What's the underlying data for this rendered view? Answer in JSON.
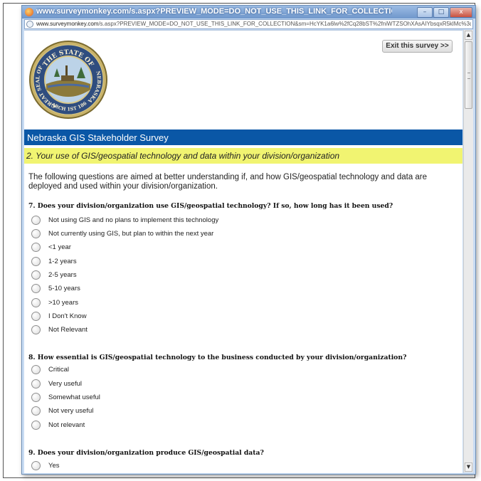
{
  "window": {
    "title": "www.surveymonkey.com/s.aspx?PREVIEW_MODE=DO_NOT_USE_THIS_LINK_FOR_COLLECTION&sm=HcYK1a6lw%2f...",
    "address_domain": "www.surveymonkey.com",
    "address_path": "/s.aspx?PREVIEW_MODE=DO_NOT_USE_THIS_LINK_FOR_COLLECTION&sm=HcYK1a6lw%2fCq28bST%2fniWTZSOhXAsAIYbsqxR5klMc%3d",
    "btn_min": "–",
    "btn_max": "□",
    "btn_close": "x"
  },
  "seal": {
    "top_text": "THE STATE OF",
    "left_text": "GREAT SEAL OF",
    "right_text": "NEBRASKA",
    "bottom_text": "MARCH 1ST 1867"
  },
  "exit_button": "Exit this survey >>",
  "survey_title": "Nebraska GIS Stakeholder Survey",
  "section_title": "2. Your use of GIS/geospatial technology and data within your division/organization",
  "intro": "The following questions are aimed at better understanding if, and how GIS/geospatial technology and data are deployed and used within your division/organization.",
  "questions": [
    {
      "title": "7. Does your division/organization use GIS/geospatial technology? If so, how long has it been used?",
      "options": [
        "Not using GIS and no plans to implement this technology",
        "Not currently using GIS, but plan to within the next year",
        "<1 year",
        "1-2 years",
        "2-5 years",
        "5-10 years",
        ">10 years",
        "I Don't Know",
        "Not Relevant"
      ]
    },
    {
      "title": "8. How essential is GIS/geospatial technology to the business conducted by your division/organization?",
      "options": [
        "Critical",
        "Very useful",
        "Somewhat useful",
        "Not very useful",
        "Not relevant"
      ]
    },
    {
      "title": "9. Does your division/organization produce GIS/geospatial data?",
      "options": [
        "Yes"
      ]
    }
  ],
  "colors": {
    "title_bar_blue": "#0a57a6",
    "section_yellow": "#f1f471"
  }
}
